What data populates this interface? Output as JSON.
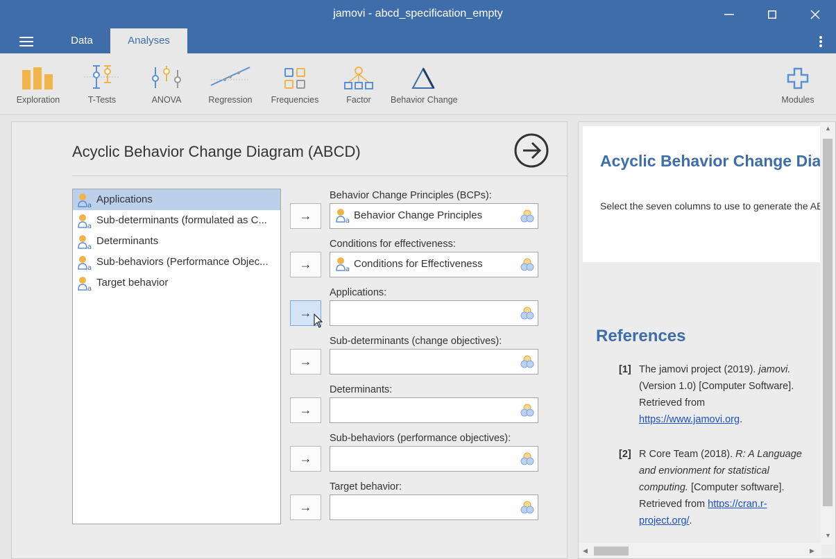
{
  "window": {
    "title": "jamovi - abcd_specification_empty"
  },
  "tabs": [
    {
      "label": "Data"
    },
    {
      "label": "Analyses"
    }
  ],
  "ribbon": {
    "items": [
      {
        "label": "Exploration",
        "icon": "exploration-icon"
      },
      {
        "label": "T-Tests",
        "icon": "ttests-icon"
      },
      {
        "label": "ANOVA",
        "icon": "anova-icon"
      },
      {
        "label": "Regression",
        "icon": "regression-icon"
      },
      {
        "label": "Frequencies",
        "icon": "frequencies-icon"
      },
      {
        "label": "Factor",
        "icon": "factor-icon"
      },
      {
        "label": "Behavior Change",
        "icon": "triangle-icon"
      },
      {
        "label": "Modules",
        "icon": "plus-icon"
      }
    ]
  },
  "options": {
    "title": "Acyclic Behavior Change Diagram (ABCD)",
    "variables": [
      {
        "label": "Applications",
        "selected": true
      },
      {
        "label": "Sub-determinants (formulated as C...",
        "selected": false
      },
      {
        "label": "Determinants",
        "selected": false
      },
      {
        "label": "Sub-behaviors (Performance Objec...",
        "selected": false
      },
      {
        "label": "Target behavior",
        "selected": false
      }
    ],
    "targets": [
      {
        "label": "Behavior Change Principles (BCPs):",
        "value": "Behavior Change Principles"
      },
      {
        "label": "Conditions for effectiveness:",
        "value": "Conditions for Effectiveness"
      },
      {
        "label": "Applications:",
        "value": ""
      },
      {
        "label": "Sub-determinants (change objectives):",
        "value": ""
      },
      {
        "label": "Determinants:",
        "value": ""
      },
      {
        "label": "Sub-behaviors (performance objectives):",
        "value": ""
      },
      {
        "label": "Target behavior:",
        "value": ""
      }
    ],
    "arrow_glyph": "→"
  },
  "results": {
    "title": "Acyclic Behavior Change Diagram (ABCD)",
    "description": "Select the seven columns to use to generate the ABCD.",
    "references_heading": "References",
    "references": [
      {
        "num": "[1]",
        "text_before": "The jamovi project (2019). ",
        "italic": "jamovi.",
        "text_after": " (Version 1.0) [Computer Software]. Retrieved from ",
        "link": "https://www.jamovi.org",
        "tail": "."
      },
      {
        "num": "[2]",
        "text_before": "R Core Team (2018). ",
        "italic": "R: A Language and envionment for statistical computing.",
        "text_after": " [Computer software]. Retrieved from ",
        "link": "https://cran.r-project.org/",
        "tail": "."
      }
    ]
  },
  "colors": {
    "brand": "#3e6da9",
    "selected_row": "#bcd0ec",
    "icon_orange": "#f0b54a",
    "icon_blue": "#5b8fd6",
    "link": "#1a4fcc"
  }
}
